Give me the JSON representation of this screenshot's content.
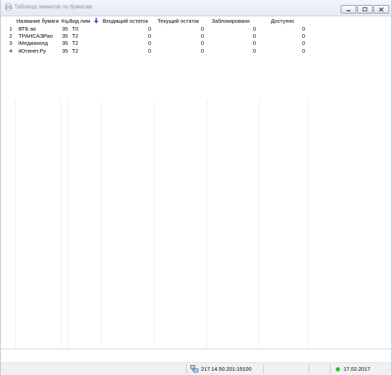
{
  "window": {
    "title": "Таблица лимитов по бумагам"
  },
  "table": {
    "columns": [
      "Название бумаги",
      "Код",
      "Вид лим",
      "Входящий остаток",
      "Текущий остаток",
      "Заблокировано",
      "Доступно"
    ],
    "rows": [
      {
        "n": "1",
        "name": "ВТБ ао",
        "code": "35",
        "kind": "T0",
        "incoming": "0",
        "current": "0",
        "blocked": "0",
        "available": "0"
      },
      {
        "n": "2",
        "name": "ТРАНСАЭРао",
        "code": "35",
        "kind": "T2",
        "incoming": "0",
        "current": "0",
        "blocked": "0",
        "available": "0"
      },
      {
        "n": "3",
        "name": "iМедиахолд",
        "code": "35",
        "kind": "T2",
        "incoming": "0",
        "current": "0",
        "blocked": "0",
        "available": "0"
      },
      {
        "n": "4",
        "name": "iЮтинет.Ру",
        "code": "35",
        "kind": "T2",
        "incoming": "0",
        "current": "0",
        "blocked": "0",
        "available": "0"
      }
    ]
  },
  "statusbar": {
    "connection": "217.14.50.201:15100",
    "date": "17.02.2017",
    "status_color": "#2cc12c"
  },
  "icons": {
    "title": "printer-icon",
    "sort": "sort-desc-arrow-icon",
    "connection": "network-icon",
    "status": "status-dot-icon"
  }
}
